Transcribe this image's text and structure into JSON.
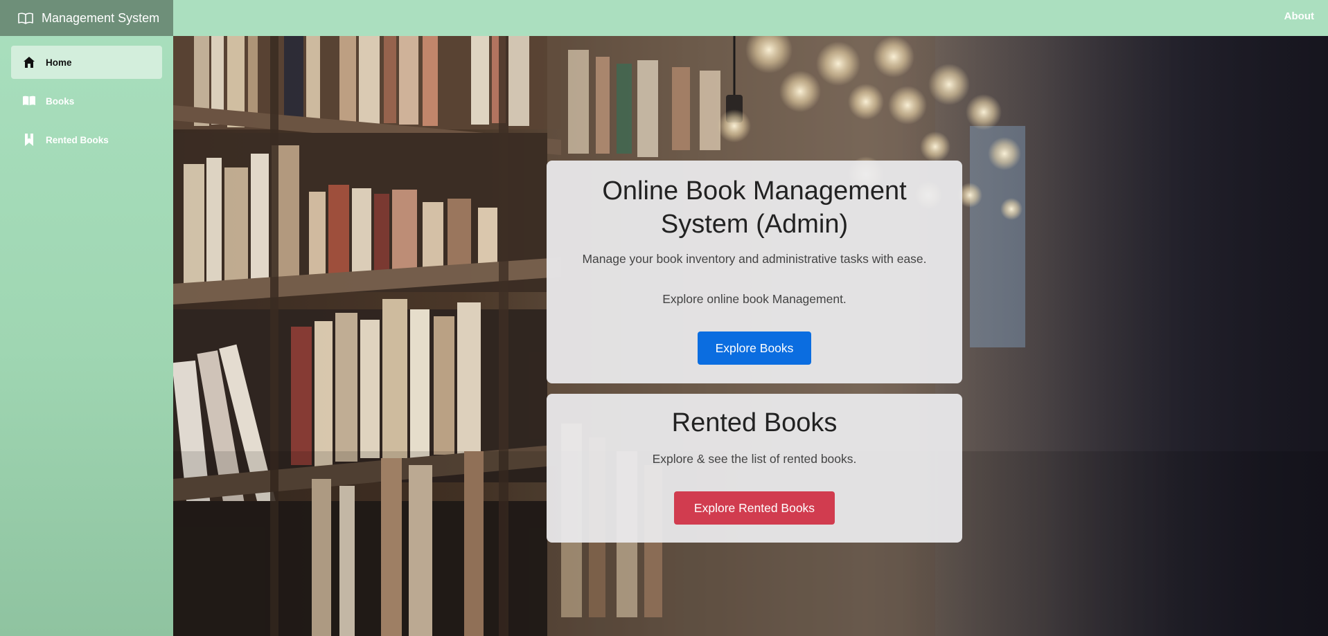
{
  "brand": {
    "title": "Management System",
    "icon": "open-book-icon"
  },
  "sidebar": {
    "items": [
      {
        "label": "Home",
        "icon": "home-icon",
        "active": true
      },
      {
        "label": "Books",
        "icon": "book-icon",
        "active": false
      },
      {
        "label": "Rented Books",
        "icon": "bookmark-icon",
        "active": false
      }
    ]
  },
  "topbar": {
    "about_label": "About"
  },
  "admin_card": {
    "title": "Online Book Management System (Admin)",
    "text1": "Manage your book inventory and administrative tasks with ease.",
    "text2": "Explore online book Management.",
    "button_label": "Explore Books"
  },
  "rented_card": {
    "title": "Rented Books",
    "text": "Explore & see the list of rented books.",
    "button_label": "Explore Rented Books"
  },
  "colors": {
    "sidebar": "#a9dfbe",
    "brand_bar": "#6e8f79",
    "topbar": "#abdfbf",
    "primary": "#0b6de0",
    "danger": "#d13c4f"
  }
}
